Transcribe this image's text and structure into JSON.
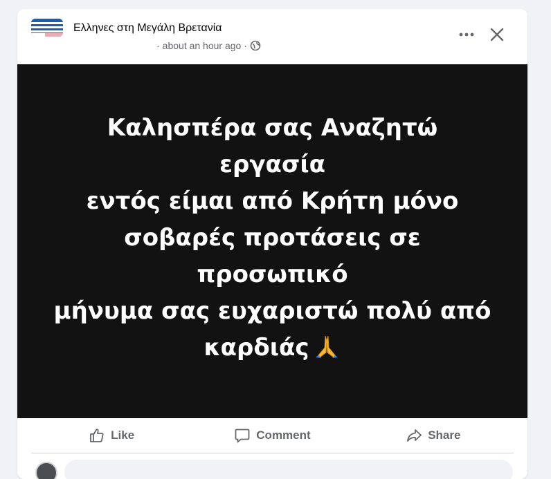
{
  "post": {
    "group_name": "Ελληνες στη Μεγάλη Βρετανία",
    "dot_separator": "·",
    "timestamp": "about an hour ago",
    "privacy_icon": "globe-icon",
    "more_icon": "more-horizontal-icon",
    "close_icon": "close-icon",
    "image_text_lines": [
      "Καλησπέρα σας Αναζητώ εργασία",
      "εντός είμαι από Κρήτη μόνο",
      "σοβαρές προτάσεις σε προσωπικό",
      "μήνυμα σας ευχαριστώ πολύ από",
      "καρδιάς"
    ],
    "image_emoji": "folded-hands-emoji",
    "image_background": "#121212"
  },
  "actions": {
    "like_label": "Like",
    "comment_label": "Comment",
    "share_label": "Share",
    "like_icon": "thumbs-up-icon",
    "comment_icon": "comment-icon",
    "share_icon": "share-icon"
  },
  "comment_box": {
    "placeholder": ""
  },
  "colors": {
    "page_background": "#f0f2f5",
    "secondary_text": "#65676b",
    "primary_text": "#050505"
  }
}
